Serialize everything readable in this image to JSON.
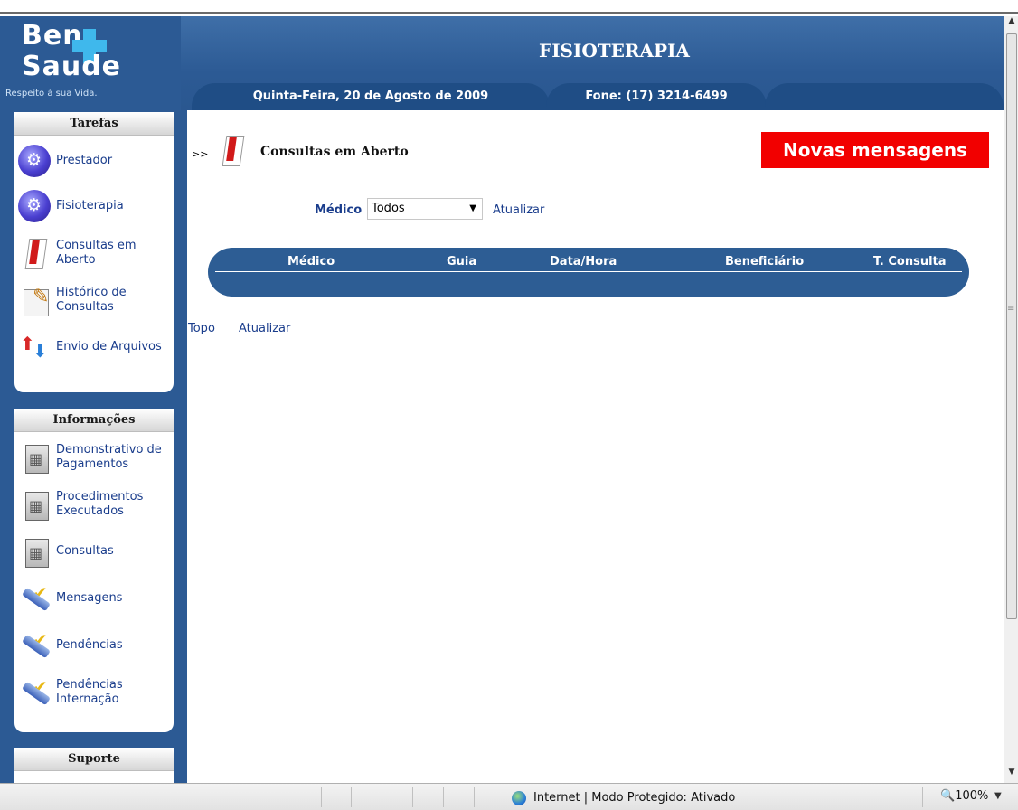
{
  "header": {
    "logo_line1": "Ben",
    "logo_line2": "Saude",
    "logo_tagline": "Respeito à sua Vida.",
    "title": "FISIOTERAPIA",
    "date_tab": "Quinta-Feira, 20 de Agosto de 2009",
    "phone_tab": "Fone: (17) 3214-6499"
  },
  "sidebar": {
    "tarefas": {
      "title": "Tarefas",
      "items": [
        {
          "label": "Prestador",
          "icon": "globe-gear-icon"
        },
        {
          "label": "Fisioterapia",
          "icon": "globe-gear-icon"
        },
        {
          "label": "Consultas em Aberto",
          "icon": "book-icon"
        },
        {
          "label": "Histórico de Consultas",
          "icon": "notepad-icon"
        },
        {
          "label": "Envio de Arquivos",
          "icon": "upload-arrows-icon"
        }
      ]
    },
    "informacoes": {
      "title": "Informações",
      "items": [
        {
          "label": "Demonstrativo de Pagamentos",
          "icon": "calculator-icon"
        },
        {
          "label": "Procedimentos Executados",
          "icon": "calculator-icon"
        },
        {
          "label": "Consultas",
          "icon": "calculator-icon"
        },
        {
          "label": "Mensagens",
          "icon": "tools-check-icon"
        },
        {
          "label": "Pendências",
          "icon": "tools-check-icon"
        },
        {
          "label": "Pendências Internação",
          "icon": "tools-check-icon"
        }
      ]
    },
    "suporte": {
      "title": "Suporte"
    }
  },
  "main": {
    "breadcrumb_arrow": ">>",
    "page_title": "Consultas em Aberto",
    "new_messages_button": "Novas mensagens",
    "filter_label": "Médico",
    "filter_selected": "Todos",
    "refresh_link": "Atualizar",
    "table_headers": [
      "Médico",
      "Guia",
      "Data/Hora",
      "Beneficiário",
      "T. Consulta"
    ],
    "footer_links": [
      "Topo",
      "Atualizar"
    ]
  },
  "statusbar": {
    "zone": "Internet | Modo Protegido: Ativado",
    "zoom": "100%"
  },
  "colors": {
    "header_blue": "#2c5a94",
    "alert_red": "#f20000",
    "link_blue": "#1a3d8c"
  }
}
